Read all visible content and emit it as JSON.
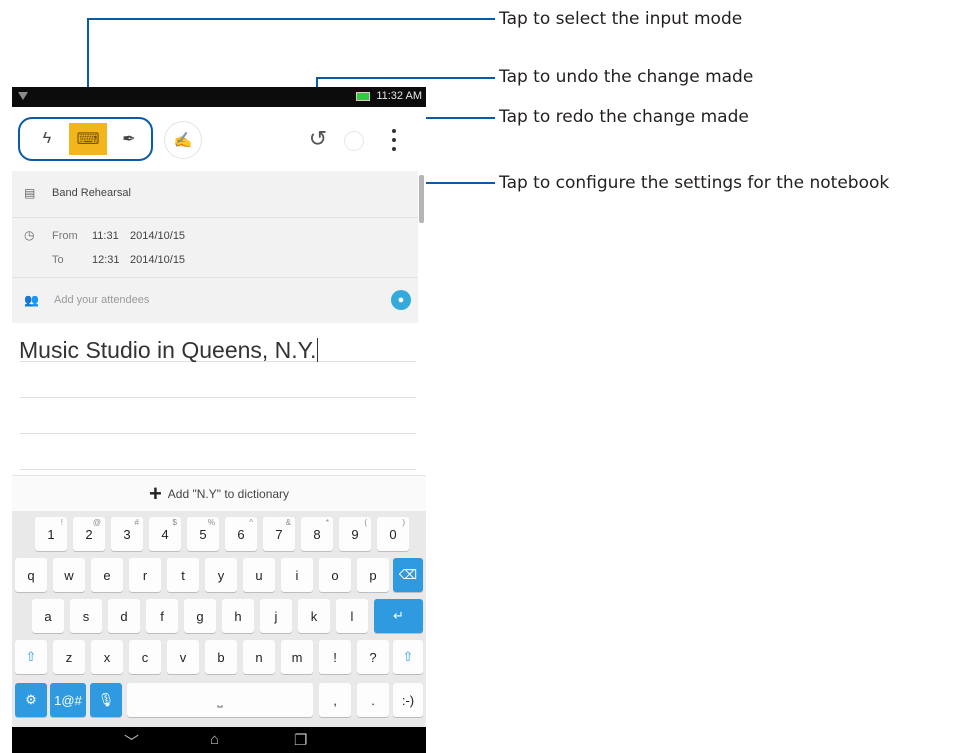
{
  "callouts": {
    "input_mode": "Tap to select the input mode",
    "undo": "Tap to undo the change made",
    "redo": "Tap to redo the change made",
    "settings": "Tap to configure the settings for the notebook"
  },
  "status_bar": {
    "time": "11:32 AM"
  },
  "event": {
    "title": "Band Rehearsal",
    "from_label": "From",
    "from_time": "11:31",
    "from_date": "2014/10/15",
    "to_label": "To",
    "to_time": "12:31",
    "to_date": "2014/10/15",
    "attendees_placeholder": "Add your attendees"
  },
  "note": {
    "text": "Music Studio in Queens, N.Y."
  },
  "dictionary": {
    "label": "Add \"N.Y\" to dictionary"
  },
  "keyboard": {
    "row1": [
      "1",
      "2",
      "3",
      "4",
      "5",
      "6",
      "7",
      "8",
      "9",
      "0"
    ],
    "row1_sup": [
      "!",
      "@",
      "#",
      "$",
      "%",
      "^",
      "&",
      "*",
      "(",
      ")"
    ],
    "row2": [
      "q",
      "w",
      "e",
      "r",
      "t",
      "y",
      "u",
      "i",
      "o",
      "p"
    ],
    "row3": [
      "a",
      "s",
      "d",
      "f",
      "g",
      "h",
      "j",
      "k",
      "l"
    ],
    "row4": [
      "z",
      "x",
      "c",
      "v",
      "b",
      "n",
      "m",
      "!",
      "?"
    ],
    "symbols_key": "1@#",
    "comma": ",",
    "period": ".",
    "emoticon": ":-)"
  },
  "colors": {
    "accent": "#0a5aa8",
    "active_mode": "#f2b51c",
    "key_blue": "#2f9ae0"
  }
}
